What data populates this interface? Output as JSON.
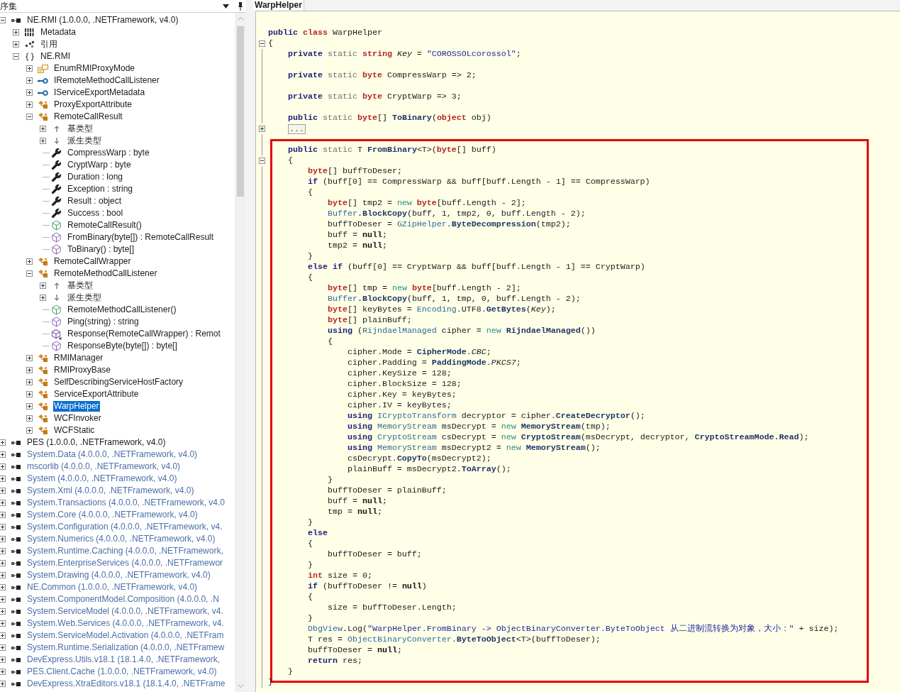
{
  "assembly_panel": {
    "title": "序集",
    "tree": [
      {
        "label": "NE.RMI (1.0.0.0, .NETFramework, v4.0)",
        "kind": "assembly",
        "loaded": true,
        "expanded": true,
        "selected": false,
        "children": [
          {
            "label": "Metadata",
            "kind": "metadata",
            "expanded": false,
            "selected": false
          },
          {
            "label": "引用",
            "kind": "references",
            "expanded": false,
            "selected": false
          },
          {
            "label": "NE.RMI",
            "kind": "namespace",
            "expanded": true,
            "selected": false,
            "children": [
              {
                "label": "EnumRMIProxyMode",
                "kind": "enum",
                "expanded": false,
                "selected": false
              },
              {
                "label": "IRemoteMethodCallListener",
                "kind": "interface",
                "expanded": false,
                "selected": false
              },
              {
                "label": "IServiceExportMetadata",
                "kind": "interface",
                "expanded": false,
                "selected": false
              },
              {
                "label": "ProxyExportAttribute",
                "kind": "class",
                "expanded": false,
                "selected": false
              },
              {
                "label": "RemoteCallResult",
                "kind": "class",
                "expanded": true,
                "selected": false,
                "children": [
                  {
                    "label": "基类型",
                    "kind": "base-types",
                    "expanded": false,
                    "selected": false
                  },
                  {
                    "label": "派生类型",
                    "kind": "derived-types",
                    "expanded": false,
                    "selected": false
                  },
                  {
                    "label": "CompressWarp : byte",
                    "kind": "property",
                    "selected": false
                  },
                  {
                    "label": "CryptWarp : byte",
                    "kind": "property",
                    "selected": false
                  },
                  {
                    "label": "Duration : long",
                    "kind": "property",
                    "selected": false
                  },
                  {
                    "label": "Exception : string",
                    "kind": "property",
                    "selected": false
                  },
                  {
                    "label": "Result : object",
                    "kind": "property",
                    "selected": false
                  },
                  {
                    "label": "Success : bool",
                    "kind": "property",
                    "selected": false
                  },
                  {
                    "label": "RemoteCallResult()",
                    "kind": "constructor",
                    "selected": false
                  },
                  {
                    "label": "FromBinary(byte[]) : RemoteCallResult",
                    "kind": "method",
                    "selected": false
                  },
                  {
                    "label": "ToBinary() : byte[]",
                    "kind": "method",
                    "selected": false
                  }
                ]
              },
              {
                "label": "RemoteCallWrapper",
                "kind": "class",
                "expanded": false,
                "selected": false
              },
              {
                "label": "RemoteMethodCallListener",
                "kind": "class",
                "expanded": true,
                "selected": false,
                "children": [
                  {
                    "label": "基类型",
                    "kind": "base-types",
                    "expanded": false,
                    "selected": false
                  },
                  {
                    "label": "派生类型",
                    "kind": "derived-types",
                    "expanded": false,
                    "selected": false
                  },
                  {
                    "label": "RemoteMethodCallListener()",
                    "kind": "constructor",
                    "selected": false
                  },
                  {
                    "label": "Ping(string) : string",
                    "kind": "method",
                    "selected": false
                  },
                  {
                    "label": "Response(RemoteCallWrapper) : Remot",
                    "kind": "protected-method",
                    "selected": false
                  },
                  {
                    "label": "ResponseByte(byte[]) : byte[]",
                    "kind": "method",
                    "selected": false
                  }
                ]
              },
              {
                "label": "RMIManager",
                "kind": "class",
                "expanded": false,
                "selected": false
              },
              {
                "label": "RMIProxyBase",
                "kind": "class",
                "expanded": false,
                "selected": false
              },
              {
                "label": "SelfDescribingServiceHostFactory",
                "kind": "class",
                "expanded": false,
                "selected": false
              },
              {
                "label": "ServiceExportAttribute",
                "kind": "class",
                "expanded": false,
                "selected": false
              },
              {
                "label": "WarpHelper",
                "kind": "class",
                "expanded": false,
                "selected": true
              },
              {
                "label": "WCFInvoker",
                "kind": "class",
                "expanded": false,
                "selected": false
              },
              {
                "label": "WCFStatic",
                "kind": "class",
                "expanded": false,
                "selected": false
              }
            ]
          }
        ]
      },
      {
        "label": "PES (1.0.0.0, .NETFramework, v4.0)",
        "kind": "assembly",
        "loaded": true,
        "expanded": false,
        "selected": false
      },
      {
        "label": "System.Data (4.0.0.0, .NETFramework, v4.0)",
        "kind": "assembly",
        "loaded": false,
        "expanded": false,
        "selected": false
      },
      {
        "label": "mscorlib (4.0.0.0, .NETFramework, v4.0)",
        "kind": "assembly",
        "loaded": false,
        "expanded": false,
        "selected": false
      },
      {
        "label": "System (4.0.0.0, .NETFramework, v4.0)",
        "kind": "assembly",
        "loaded": false,
        "expanded": false,
        "selected": false
      },
      {
        "label": "System.Xml (4.0.0.0, .NETFramework, v4.0)",
        "kind": "assembly",
        "loaded": false,
        "expanded": false,
        "selected": false
      },
      {
        "label": "System.Transactions (4.0.0.0, .NETFramework, v4.0",
        "kind": "assembly",
        "loaded": false,
        "expanded": false,
        "selected": false
      },
      {
        "label": "System.Core (4.0.0.0, .NETFramework, v4.0)",
        "kind": "assembly",
        "loaded": false,
        "expanded": false,
        "selected": false
      },
      {
        "label": "System.Configuration (4.0.0.0, .NETFramework, v4.",
        "kind": "assembly",
        "loaded": false,
        "expanded": false,
        "selected": false
      },
      {
        "label": "System.Numerics (4.0.0.0, .NETFramework, v4.0)",
        "kind": "assembly",
        "loaded": false,
        "expanded": false,
        "selected": false
      },
      {
        "label": "System.Runtime.Caching (4.0.0.0, .NETFramework,",
        "kind": "assembly",
        "loaded": false,
        "expanded": false,
        "selected": false
      },
      {
        "label": "System.EnterpriseServices (4.0.0.0, .NETFramewor",
        "kind": "assembly",
        "loaded": false,
        "expanded": false,
        "selected": false
      },
      {
        "label": "System.Drawing (4.0.0.0, .NETFramework, v4.0)",
        "kind": "assembly",
        "loaded": false,
        "expanded": false,
        "selected": false
      },
      {
        "label": "NE.Common (1.0.0.0, .NETFramework, v4.0)",
        "kind": "assembly",
        "loaded": false,
        "expanded": false,
        "selected": false
      },
      {
        "label": "System.ComponentModel.Composition (4.0.0.0, .N",
        "kind": "assembly",
        "loaded": false,
        "expanded": false,
        "selected": false
      },
      {
        "label": "System.ServiceModel (4.0.0.0, .NETFramework, v4.",
        "kind": "assembly",
        "loaded": false,
        "expanded": false,
        "selected": false
      },
      {
        "label": "System.Web.Services (4.0.0.0, .NETFramework, v4.",
        "kind": "assembly",
        "loaded": false,
        "expanded": false,
        "selected": false
      },
      {
        "label": "System.ServiceModel.Activation (4.0.0.0, .NETFram",
        "kind": "assembly",
        "loaded": false,
        "expanded": false,
        "selected": false
      },
      {
        "label": "System.Runtime.Serialization (4.0.0.0, .NETFramew",
        "kind": "assembly",
        "loaded": false,
        "expanded": false,
        "selected": false
      },
      {
        "label": "DevExpress.Utils.v18.1 (18.1.4.0, .NETFramework,",
        "kind": "assembly",
        "loaded": false,
        "expanded": false,
        "selected": false
      },
      {
        "label": "PES.Client.Cache (1.0.0.0, .NETFramework, v4.0)",
        "kind": "assembly",
        "loaded": false,
        "expanded": false,
        "selected": false
      },
      {
        "label": "DevExpress.XtraEditors.v18.1 (18.1.4.0, .NETFrame",
        "kind": "assembly",
        "loaded": false,
        "expanded": false,
        "selected": false
      }
    ]
  },
  "editor": {
    "tabs": [
      {
        "label": "WarpHelper",
        "selected": true
      }
    ],
    "code": {
      "lines": [
        {
          "tokens": [
            {
              "kind": "kw",
              "text": "public"
            },
            {
              "kind": "type",
              "text": " class"
            },
            {
              "kind": "p",
              "text": " WarpHelper"
            }
          ]
        },
        {
          "expanded": true,
          "tokens": [
            {
              "kind": "p",
              "text": "{"
            }
          ]
        },
        {
          "tokens": [
            {
              "kind": "kw",
              "text": "    private"
            },
            {
              "kind": "mod",
              "text": " static"
            },
            {
              "kind": "type",
              "text": " string"
            },
            {
              "kind": "it",
              "text": " Key"
            },
            {
              "kind": "p",
              "text": " ="
            },
            {
              "kind": "str",
              "text": " \"COROSSOLcorossol\""
            },
            {
              "kind": "p",
              "text": ";"
            }
          ]
        },
        {
          "kind": "blank"
        },
        {
          "tokens": [
            {
              "kind": "kw",
              "text": "    private"
            },
            {
              "kind": "mod",
              "text": " static"
            },
            {
              "kind": "type",
              "text": " byte"
            },
            {
              "kind": "p",
              "text": " CompressWarp => 2;"
            }
          ]
        },
        {
          "kind": "blank"
        },
        {
          "tokens": [
            {
              "kind": "kw",
              "text": "    private"
            },
            {
              "kind": "mod",
              "text": " static"
            },
            {
              "kind": "type",
              "text": " byte"
            },
            {
              "kind": "p",
              "text": " CryptWarp => 3;"
            }
          ]
        },
        {
          "kind": "blank"
        },
        {
          "tokens": [
            {
              "kind": "kw",
              "text": "    public"
            },
            {
              "kind": "mod",
              "text": " static"
            },
            {
              "kind": "type",
              "text": " byte"
            },
            {
              "kind": "p",
              "text": "[] "
            },
            {
              "kind": "fn",
              "text": "ToBinary"
            },
            {
              "kind": "p",
              "text": "("
            },
            {
              "kind": "type",
              "text": "object"
            },
            {
              "kind": "p",
              "text": " obj)"
            }
          ]
        },
        {
          "kind": "collapsed",
          "expanded": false,
          "text": "..."
        },
        {
          "kind": "blank"
        }
      ],
      "highlight": {
        "lines": [
          {
            "tokens": [
              {
                "kind": "kw",
                "text": "    public"
              },
              {
                "kind": "mod",
                "text": " static"
              },
              {
                "kind": "p",
                "text": " T "
              },
              {
                "kind": "fn",
                "text": "FromBinary"
              },
              {
                "kind": "p",
                "text": "<T>("
              },
              {
                "kind": "type",
                "text": "byte"
              },
              {
                "kind": "p",
                "text": "[] buff)"
              }
            ]
          },
          {
            "expanded": true,
            "tokens": [
              {
                "kind": "p",
                "text": "    {"
              }
            ]
          },
          {
            "tokens": [
              {
                "kind": "type",
                "text": "        byte"
              },
              {
                "kind": "p",
                "text": "[] buffToDeser;"
              }
            ]
          },
          {
            "tokens": [
              {
                "kind": "kw",
                "text": "        if"
              },
              {
                "kind": "p",
                "text": " (buff[0] == CompressWarp && buff[buff.Length - 1] == CompressWarp)"
              }
            ]
          },
          {
            "tokens": [
              {
                "kind": "p",
                "text": "        {"
              }
            ]
          },
          {
            "tokens": [
              {
                "kind": "type",
                "text": "            byte"
              },
              {
                "kind": "p",
                "text": "[] tmp2 = "
              },
              {
                "kind": "new",
                "text": "new"
              },
              {
                "kind": "type",
                "text": " byte"
              },
              {
                "kind": "p",
                "text": "[buff.Length - 2];"
              }
            ]
          },
          {
            "tokens": [
              {
                "kind": "cls",
                "text": "            Buffer"
              },
              {
                "kind": "p",
                "text": "."
              },
              {
                "kind": "fn",
                "text": "BlockCopy"
              },
              {
                "kind": "p",
                "text": "(buff, 1, tmp2, 0, buff.Length - 2);"
              }
            ]
          },
          {
            "tokens": [
              {
                "kind": "p",
                "text": "            buffToDeser = "
              },
              {
                "kind": "cls",
                "text": "GZipHelper"
              },
              {
                "kind": "p",
                "text": "."
              },
              {
                "kind": "fn",
                "text": "ByteDecompression"
              },
              {
                "kind": "p",
                "text": "(tmp2);"
              }
            ]
          },
          {
            "tokens": [
              {
                "kind": "p",
                "text": "            buff = "
              },
              {
                "kind": "nul",
                "text": "null"
              },
              {
                "kind": "p",
                "text": ";"
              }
            ]
          },
          {
            "tokens": [
              {
                "kind": "p",
                "text": "            tmp2 = "
              },
              {
                "kind": "nul",
                "text": "null"
              },
              {
                "kind": "p",
                "text": ";"
              }
            ]
          },
          {
            "tokens": [
              {
                "kind": "p",
                "text": "        }"
              }
            ]
          },
          {
            "tokens": [
              {
                "kind": "kw",
                "text": "        else if"
              },
              {
                "kind": "p",
                "text": " (buff[0] == CryptWarp && buff[buff.Length - 1] == CryptWarp)"
              }
            ]
          },
          {
            "tokens": [
              {
                "kind": "p",
                "text": "        {"
              }
            ]
          },
          {
            "tokens": [
              {
                "kind": "type",
                "text": "            byte"
              },
              {
                "kind": "p",
                "text": "[] tmp = "
              },
              {
                "kind": "new",
                "text": "new"
              },
              {
                "kind": "type",
                "text": " byte"
              },
              {
                "kind": "p",
                "text": "[buff.Length - 2];"
              }
            ]
          },
          {
            "tokens": [
              {
                "kind": "cls",
                "text": "            Buffer"
              },
              {
                "kind": "p",
                "text": "."
              },
              {
                "kind": "fn",
                "text": "BlockCopy"
              },
              {
                "kind": "p",
                "text": "(buff, 1, tmp, 0, buff.Length - 2);"
              }
            ]
          },
          {
            "tokens": [
              {
                "kind": "type",
                "text": "            byte"
              },
              {
                "kind": "p",
                "text": "[] keyBytes = "
              },
              {
                "kind": "cls",
                "text": "Encoding"
              },
              {
                "kind": "p",
                "text": ".UTF8."
              },
              {
                "kind": "fn",
                "text": "GetBytes"
              },
              {
                "kind": "p",
                "text": "("
              },
              {
                "kind": "it",
                "text": "Key"
              },
              {
                "kind": "p",
                "text": ");"
              }
            ]
          },
          {
            "tokens": [
              {
                "kind": "type",
                "text": "            byte"
              },
              {
                "kind": "p",
                "text": "[] plainBuff;"
              }
            ]
          },
          {
            "tokens": [
              {
                "kind": "kw",
                "text": "            using"
              },
              {
                "kind": "p",
                "text": " ("
              },
              {
                "kind": "cls",
                "text": "RijndaelManaged"
              },
              {
                "kind": "p",
                "text": " cipher = "
              },
              {
                "kind": "new",
                "text": "new"
              },
              {
                "kind": "fn",
                "text": " RijndaelManaged"
              },
              {
                "kind": "p",
                "text": "())"
              }
            ]
          },
          {
            "tokens": [
              {
                "kind": "p",
                "text": "            {"
              }
            ]
          },
          {
            "tokens": [
              {
                "kind": "p",
                "text": "                cipher.Mode = "
              },
              {
                "kind": "fn",
                "text": "CipherMode"
              },
              {
                "kind": "p",
                "text": "."
              },
              {
                "kind": "it",
                "text": "CBC"
              },
              {
                "kind": "p",
                "text": ";"
              }
            ]
          },
          {
            "tokens": [
              {
                "kind": "p",
                "text": "                cipher.Padding = "
              },
              {
                "kind": "fn",
                "text": "PaddingMode"
              },
              {
                "kind": "p",
                "text": "."
              },
              {
                "kind": "it",
                "text": "PKCS7"
              },
              {
                "kind": "p",
                "text": ";"
              }
            ]
          },
          {
            "tokens": [
              {
                "kind": "p",
                "text": "                cipher.KeySize = 128;"
              }
            ]
          },
          {
            "tokens": [
              {
                "kind": "p",
                "text": "                cipher.BlockSize = 128;"
              }
            ]
          },
          {
            "tokens": [
              {
                "kind": "p",
                "text": "                cipher.Key = keyBytes;"
              }
            ]
          },
          {
            "tokens": [
              {
                "kind": "p",
                "text": "                cipher.IV = keyBytes;"
              }
            ]
          },
          {
            "tokens": [
              {
                "kind": "kw",
                "text": "                using"
              },
              {
                "kind": "cls",
                "text": " ICryptoTransform"
              },
              {
                "kind": "p",
                "text": " decryptor = cipher."
              },
              {
                "kind": "fn",
                "text": "CreateDecryptor"
              },
              {
                "kind": "p",
                "text": "();"
              }
            ]
          },
          {
            "tokens": [
              {
                "kind": "kw",
                "text": "                using"
              },
              {
                "kind": "cls",
                "text": " MemoryStream"
              },
              {
                "kind": "p",
                "text": " msDecrypt = "
              },
              {
                "kind": "new",
                "text": "new"
              },
              {
                "kind": "fn",
                "text": " MemoryStream"
              },
              {
                "kind": "p",
                "text": "(tmp);"
              }
            ]
          },
          {
            "tokens": [
              {
                "kind": "kw",
                "text": "                using"
              },
              {
                "kind": "cls",
                "text": " CryptoStream"
              },
              {
                "kind": "p",
                "text": " csDecrypt = "
              },
              {
                "kind": "new",
                "text": "new"
              },
              {
                "kind": "fn",
                "text": " CryptoStream"
              },
              {
                "kind": "p",
                "text": "(msDecrypt, decryptor, "
              },
              {
                "kind": "fn",
                "text": "CryptoStreamMode.Read"
              },
              {
                "kind": "p",
                "text": ");"
              }
            ]
          },
          {
            "tokens": [
              {
                "kind": "kw",
                "text": "                using"
              },
              {
                "kind": "cls",
                "text": " MemoryStream"
              },
              {
                "kind": "p",
                "text": " msDecrypt2 = "
              },
              {
                "kind": "new",
                "text": "new"
              },
              {
                "kind": "fn",
                "text": " MemoryStream"
              },
              {
                "kind": "p",
                "text": "();"
              }
            ]
          },
          {
            "tokens": [
              {
                "kind": "p",
                "text": "                csDecrypt."
              },
              {
                "kind": "fn",
                "text": "CopyTo"
              },
              {
                "kind": "p",
                "text": "(msDecrypt2);"
              }
            ]
          },
          {
            "tokens": [
              {
                "kind": "p",
                "text": "                plainBuff = msDecrypt2."
              },
              {
                "kind": "fn",
                "text": "ToArray"
              },
              {
                "kind": "p",
                "text": "();"
              }
            ]
          },
          {
            "tokens": [
              {
                "kind": "p",
                "text": "            }"
              }
            ]
          },
          {
            "tokens": [
              {
                "kind": "p",
                "text": "            buffToDeser = plainBuff;"
              }
            ]
          },
          {
            "tokens": [
              {
                "kind": "p",
                "text": "            buff = "
              },
              {
                "kind": "nul",
                "text": "null"
              },
              {
                "kind": "p",
                "text": ";"
              }
            ]
          },
          {
            "tokens": [
              {
                "kind": "p",
                "text": "            tmp = "
              },
              {
                "kind": "nul",
                "text": "null"
              },
              {
                "kind": "p",
                "text": ";"
              }
            ]
          },
          {
            "tokens": [
              {
                "kind": "p",
                "text": "        }"
              }
            ]
          },
          {
            "tokens": [
              {
                "kind": "kw",
                "text": "        else"
              }
            ]
          },
          {
            "tokens": [
              {
                "kind": "p",
                "text": "        {"
              }
            ]
          },
          {
            "tokens": [
              {
                "kind": "p",
                "text": "            buffToDeser = buff;"
              }
            ]
          },
          {
            "tokens": [
              {
                "kind": "p",
                "text": "        }"
              }
            ]
          },
          {
            "tokens": [
              {
                "kind": "type",
                "text": "        int"
              },
              {
                "kind": "p",
                "text": " size = 0;"
              }
            ]
          },
          {
            "tokens": [
              {
                "kind": "kw",
                "text": "        if"
              },
              {
                "kind": "p",
                "text": " (buffToDeser != "
              },
              {
                "kind": "nul",
                "text": "null"
              },
              {
                "kind": "p",
                "text": ")"
              }
            ]
          },
          {
            "tokens": [
              {
                "kind": "p",
                "text": "        {"
              }
            ]
          },
          {
            "tokens": [
              {
                "kind": "p",
                "text": "            size = buffToDeser.Length;"
              }
            ]
          },
          {
            "tokens": [
              {
                "kind": "p",
                "text": "        }"
              }
            ]
          },
          {
            "tokens": [
              {
                "kind": "cls",
                "text": "        DbgView"
              },
              {
                "kind": "p",
                "text": ".Log("
              },
              {
                "kind": "str",
                "text": "\"WarpHelper.FromBinary -> ObjectBinaryConverter.ByteToObject 从二进制流转换为对象，大小：\""
              },
              {
                "kind": "p",
                "text": " + size);"
              }
            ]
          },
          {
            "tokens": [
              {
                "kind": "p",
                "text": "        T res = "
              },
              {
                "kind": "cls",
                "text": "ObjectBinaryConverter"
              },
              {
                "kind": "p",
                "text": "."
              },
              {
                "kind": "fn",
                "text": "ByteToObject"
              },
              {
                "kind": "p",
                "text": "<T>(buffToDeser);"
              }
            ]
          },
          {
            "tokens": [
              {
                "kind": "p",
                "text": "        buffToDeser = "
              },
              {
                "kind": "nul",
                "text": "null"
              },
              {
                "kind": "p",
                "text": ";"
              }
            ]
          },
          {
            "tokens": [
              {
                "kind": "kw",
                "text": "        return"
              },
              {
                "kind": "p",
                "text": " res;"
              }
            ]
          },
          {
            "tokens": [
              {
                "kind": "p",
                "text": "    }"
              }
            ]
          }
        ]
      },
      "after": [
        {
          "tokens": [
            {
              "kind": "p",
              "text": "}"
            }
          ]
        }
      ]
    }
  }
}
